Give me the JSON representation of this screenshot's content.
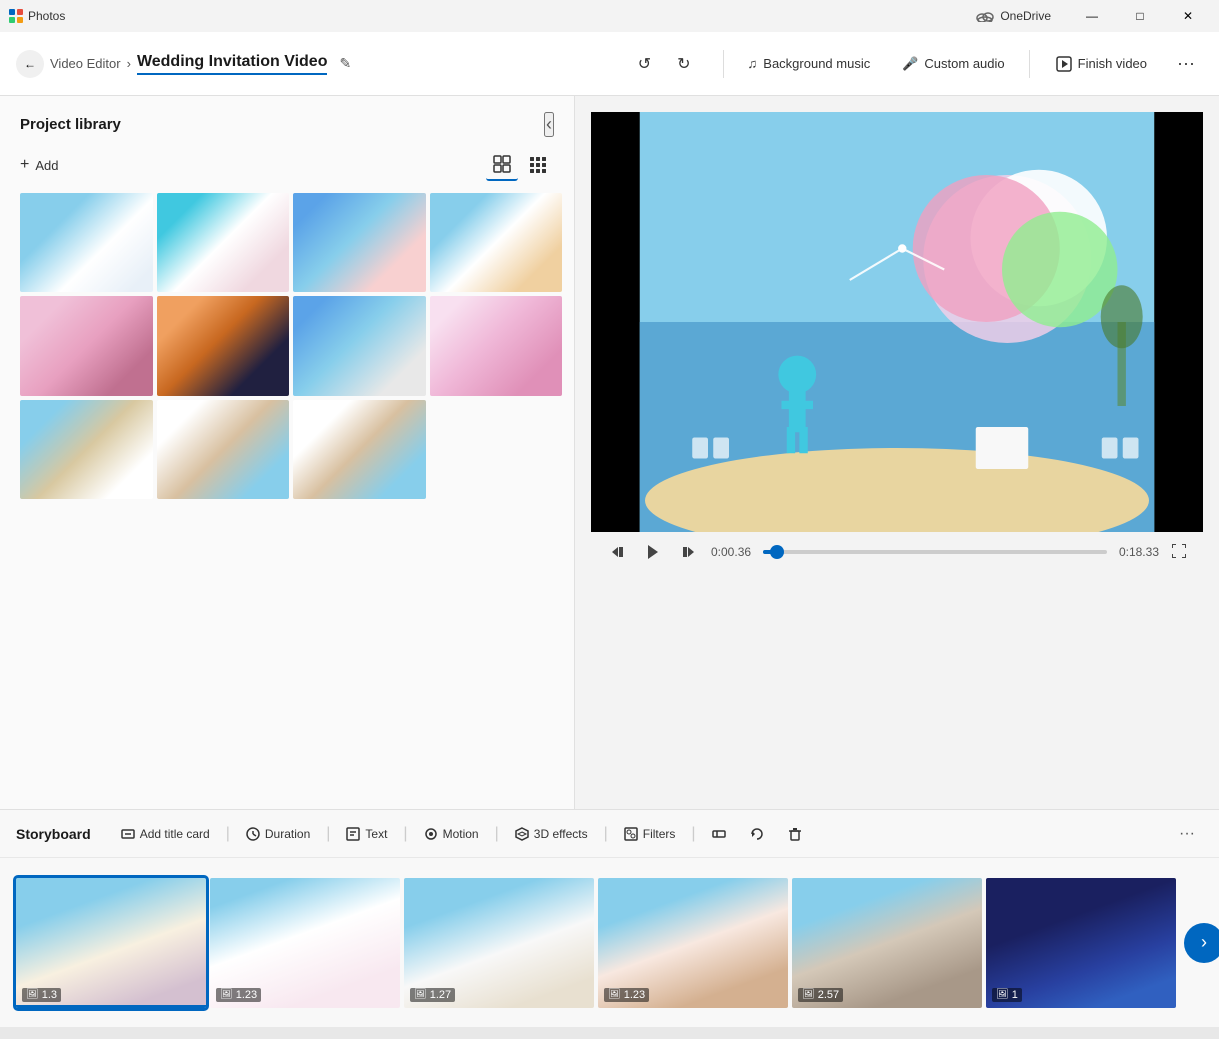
{
  "titleBar": {
    "appName": "Photos",
    "oneDrive": "OneDrive",
    "minimizeLabel": "—",
    "maximizeLabel": "□",
    "closeLabel": "✕"
  },
  "toolbar": {
    "backIcon": "←",
    "breadcrumb": "Video Editor",
    "breadcrumbSep": "›",
    "projectTitle": "Wedding Invitation Video",
    "editIcon": "✎",
    "undoIcon": "↺",
    "redoIcon": "↻",
    "bgMusicIcon": "♫",
    "bgMusicLabel": "Background music",
    "customAudioIcon": "🎤",
    "customAudioLabel": "Custom audio",
    "finishIcon": "↗",
    "finishLabel": "Finish video",
    "moreIcon": "···"
  },
  "leftPanel": {
    "title": "Project library",
    "collapseIcon": "‹",
    "addLabel": "Add",
    "addIcon": "+",
    "viewLargeIcon": "⊞",
    "viewSmallIcon": "⊟",
    "photos": [
      {
        "id": 1,
        "colorClass": "photo-1"
      },
      {
        "id": 2,
        "colorClass": "photo-2"
      },
      {
        "id": 3,
        "colorClass": "photo-3"
      },
      {
        "id": 4,
        "colorClass": "photo-4"
      },
      {
        "id": 5,
        "colorClass": "photo-5"
      },
      {
        "id": 6,
        "colorClass": "photo-6"
      },
      {
        "id": 7,
        "colorClass": "photo-7"
      },
      {
        "id": 8,
        "colorClass": "photo-8"
      },
      {
        "id": 9,
        "colorClass": "photo-9"
      },
      {
        "id": 10,
        "colorClass": "photo-10"
      },
      {
        "id": 11,
        "colorClass": "photo-11"
      }
    ]
  },
  "videoControls": {
    "rewindIcon": "⏮",
    "playIcon": "▶",
    "fastForwardIcon": "⏭",
    "currentTime": "0:00.36",
    "endTime": "0:18.33",
    "progressPercent": 4,
    "fullscreenIcon": "⛶"
  },
  "storyboard": {
    "title": "Storyboard",
    "addTitleCardIcon": "▭",
    "addTitleCardLabel": "Add title card",
    "durationIcon": "⏱",
    "durationLabel": "Duration",
    "textIcon": "T",
    "textLabel": "Text",
    "motionIcon": "◎",
    "motionLabel": "Motion",
    "effectsIcon": "✦",
    "effectsLabel": "3D effects",
    "filtersIcon": "⊡",
    "filtersLabel": "Filters",
    "trimIcon": "✂",
    "removeIcon": "🗑",
    "moreIcon": "···",
    "nextIcon": "›",
    "clips": [
      {
        "id": 1,
        "duration": "1.3",
        "colorClass": "clip-1",
        "selected": true
      },
      {
        "id": 2,
        "duration": "1.23",
        "colorClass": "clip-2",
        "selected": false
      },
      {
        "id": 3,
        "duration": "1.27",
        "colorClass": "clip-3",
        "selected": false
      },
      {
        "id": 4,
        "duration": "1.23",
        "colorClass": "clip-4",
        "selected": false
      },
      {
        "id": 5,
        "duration": "2.57",
        "colorClass": "clip-5",
        "selected": false
      },
      {
        "id": 6,
        "duration": "1",
        "colorClass": "clip-6",
        "selected": false
      }
    ],
    "clipIcon": "🖼"
  }
}
